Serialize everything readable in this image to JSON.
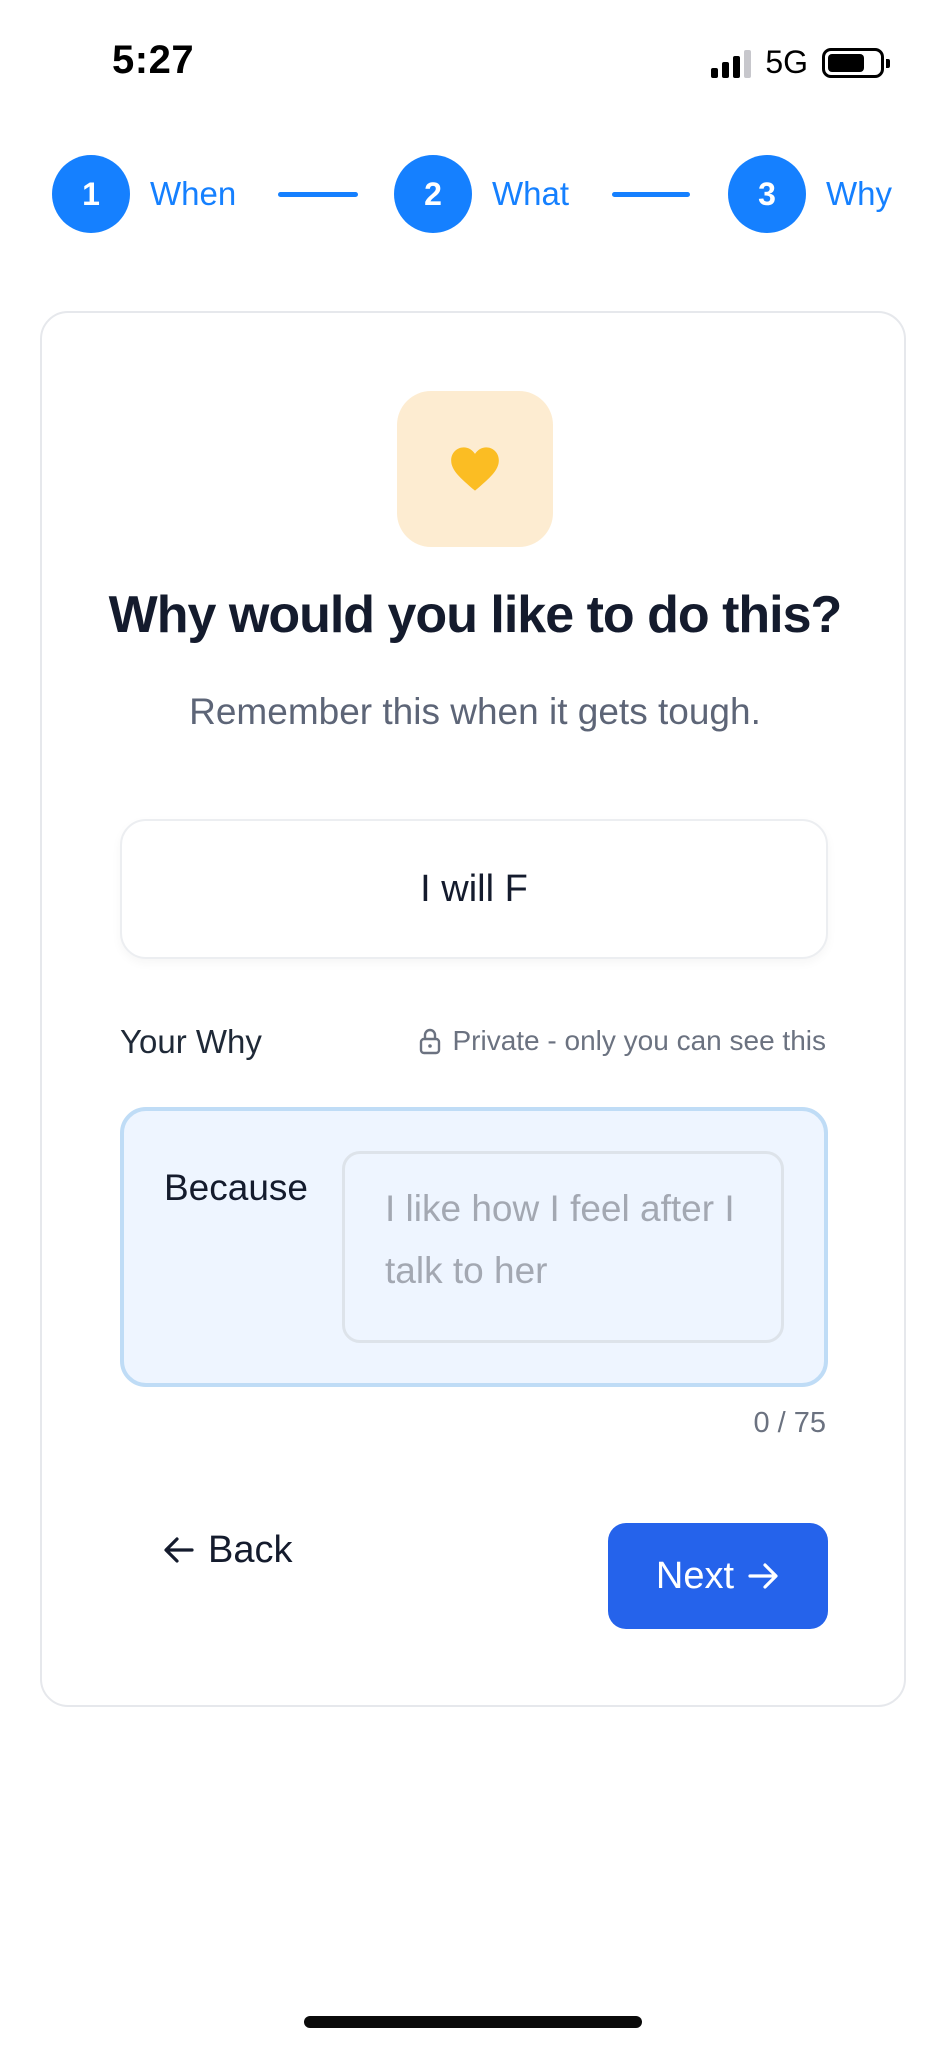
{
  "status_bar": {
    "time": "5:27",
    "network": "5G"
  },
  "stepper": {
    "steps": [
      {
        "number": "1",
        "label": "When"
      },
      {
        "number": "2",
        "label": "What"
      },
      {
        "number": "3",
        "label": "Why"
      }
    ],
    "accent_color": "#1580ff"
  },
  "card": {
    "icon": "heart-icon",
    "title": "Why would you like to do this?",
    "subtitle": "Remember this when it gets tough.",
    "intention_text": "I will F",
    "why_label": "Your Why",
    "privacy_note": "Private - only you can see this",
    "because_label": "Because",
    "because_placeholder": "I like how I feel after I talk to her",
    "because_value": "",
    "char_counter": "0 / 75",
    "back_label": "Back",
    "next_label": "Next",
    "next_color": "#2563eb"
  }
}
